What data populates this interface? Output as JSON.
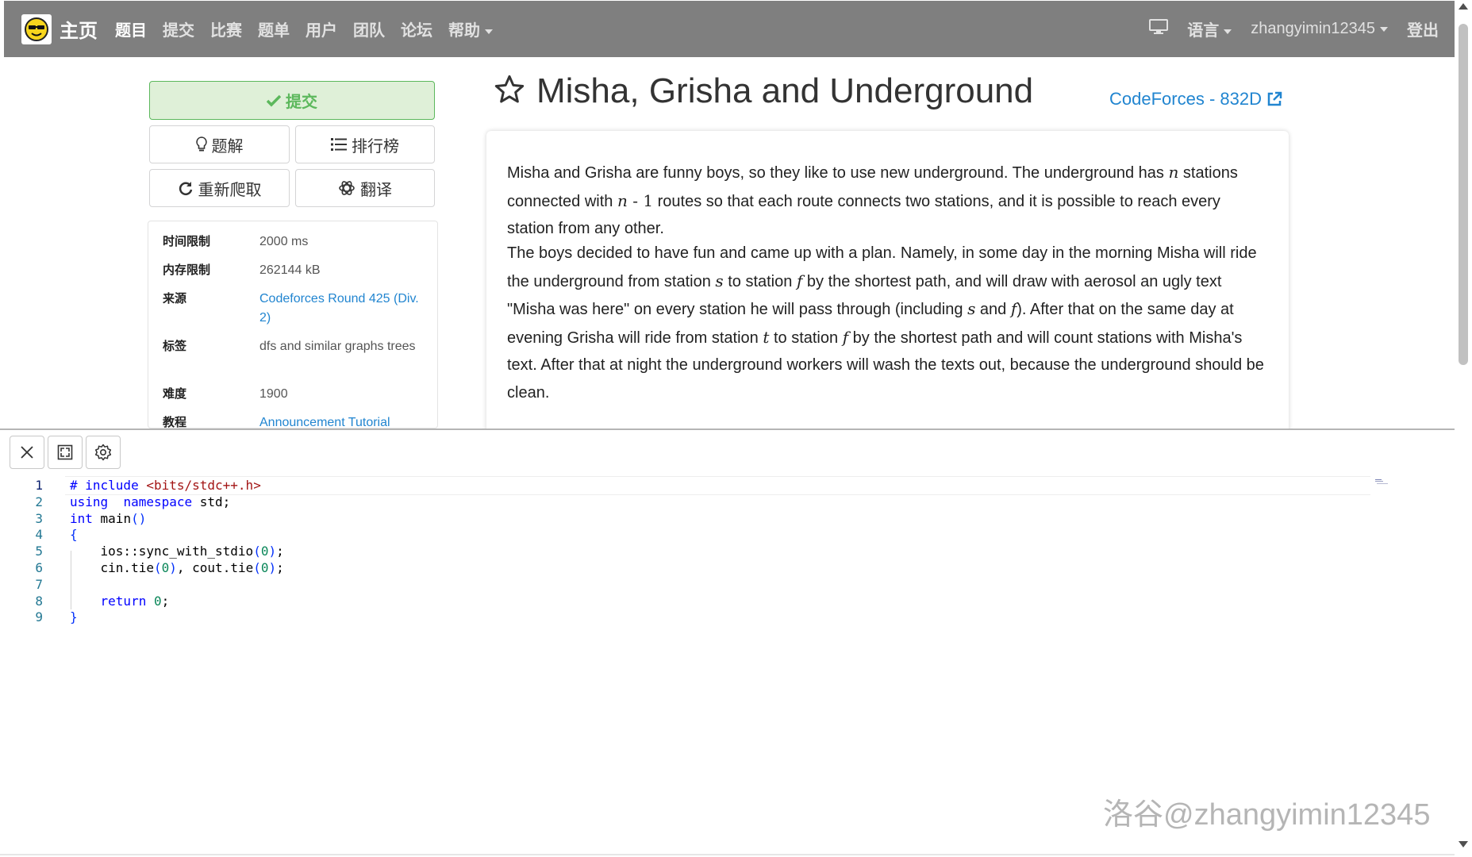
{
  "navbar": {
    "brand": "主页",
    "items": [
      {
        "label": "题目",
        "active": true
      },
      {
        "label": "提交"
      },
      {
        "label": "比赛"
      },
      {
        "label": "题单"
      },
      {
        "label": "用户"
      },
      {
        "label": "团队"
      },
      {
        "label": "论坛"
      },
      {
        "label": "帮助",
        "dropdown": true
      }
    ],
    "language": "语言",
    "username": "zhangyimin12345",
    "logout": "登出"
  },
  "actions": {
    "submit": "提交",
    "solution": "题解",
    "ranking": "排行榜",
    "refetch": "重新爬取",
    "translate": "翻译"
  },
  "info": {
    "time_limit_label": "时间限制",
    "time_limit": "2000 ms",
    "memory_limit_label": "内存限制",
    "memory_limit": "262144 kB",
    "source_label": "来源",
    "source": "Codeforces Round 425 (Div. 2)",
    "tags_label": "标签",
    "tags": "dfs and similar graphs trees",
    "difficulty_label": "难度",
    "difficulty": "1900",
    "tutorial_label": "教程",
    "tutorial": "Announcement Tutorial"
  },
  "problem": {
    "title": "Misha, Grisha and Underground",
    "source_link": "CodeForces - 832D"
  },
  "statement": {
    "p1": [
      "Misha and Grisha are funny boys, so they like to use new underground. The underground has ",
      "n",
      " stations connected with ",
      "n",
      " - 1",
      " routes so that each route connects two stations, and it is possible to reach every station from any other."
    ],
    "p2": [
      "The boys decided to have fun and came up with a plan. Namely, in some day in the morning Misha will ride the underground from station ",
      "s",
      " to station ",
      "f",
      " by the shortest path, and will draw with aerosol an ugly text \"Misha was here\" on every station he will pass through (including ",
      "s",
      " and ",
      "f",
      "). After that on the same day at evening Grisha will ride from station ",
      "t",
      " to station ",
      "f",
      " by the shortest path and will count stations with Misha's text. After that at night the underground workers will wash the texts out, because the underground should be clean."
    ]
  },
  "editor": {
    "line_numbers": [
      "1",
      "2",
      "3",
      "4",
      "5",
      "6",
      "7",
      "8",
      "9"
    ],
    "lines": [
      [
        [
          "kw",
          "# include "
        ],
        [
          "str",
          "<bits/stdc++.h>"
        ]
      ],
      [
        [
          "kw",
          "using"
        ],
        [
          "",
          "  "
        ],
        [
          "kw",
          "namespace"
        ],
        [
          "",
          " std;"
        ]
      ],
      [
        [
          "kw",
          "int"
        ],
        [
          "",
          " main"
        ],
        [
          "brk",
          "()"
        ]
      ],
      [
        [
          "brk",
          "{"
        ]
      ],
      [
        [
          "",
          "    ios::sync_with_stdio"
        ],
        [
          "brk",
          "("
        ],
        [
          "num",
          "0"
        ],
        [
          "brk",
          ")"
        ],
        [
          "",
          ";"
        ]
      ],
      [
        [
          "",
          "    cin.tie"
        ],
        [
          "brk",
          "("
        ],
        [
          "num",
          "0"
        ],
        [
          "brk",
          ")"
        ],
        [
          "",
          ", cout.tie"
        ],
        [
          "brk",
          "("
        ],
        [
          "num",
          "0"
        ],
        [
          "brk",
          ")"
        ],
        [
          "",
          ";"
        ]
      ],
      [
        [
          "",
          ""
        ]
      ],
      [
        [
          "",
          "    "
        ],
        [
          "kw",
          "return"
        ],
        [
          "",
          " "
        ],
        [
          "num",
          "0"
        ],
        [
          "",
          ";"
        ]
      ],
      [
        [
          "brk",
          "}"
        ]
      ]
    ]
  },
  "watermark": "洛谷@zhangyimin12345",
  "colors": {
    "navbar": "#7f7f7f",
    "link": "#2185d0",
    "submit_bg": "#dff0d8",
    "submit_fg": "#5cb85c"
  }
}
